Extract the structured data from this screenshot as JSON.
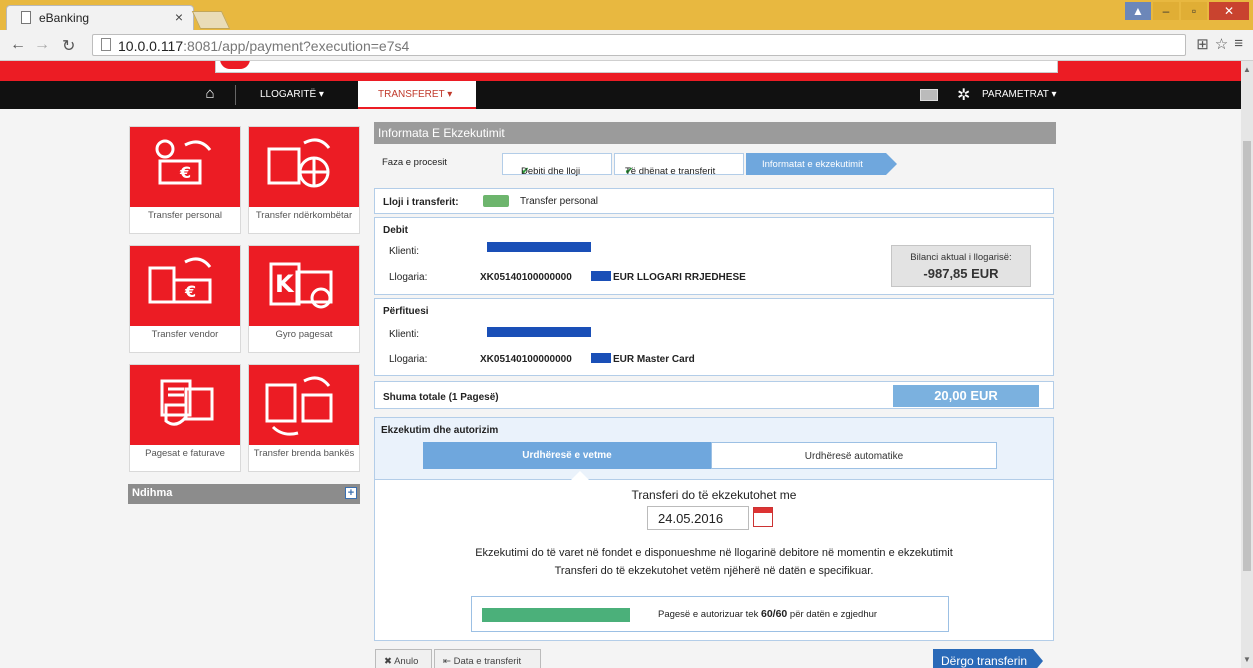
{
  "browser": {
    "tab_title": "eBanking",
    "tab_close": "×",
    "url_host": "10.0.0.117",
    "url_rest": ":8081/app/payment?execution=e7s4"
  },
  "nav": {
    "accounts": "LLOGARITË ▾",
    "transfers": "TRANSFERET ▾",
    "settings": "PARAMETRAT ▾"
  },
  "tiles": [
    {
      "label": "Transfer personal",
      "icon": "person-money-icon"
    },
    {
      "label": "Transfer ndërkombëtar",
      "icon": "building-globe-icon"
    },
    {
      "label": "Transfer vendor",
      "icon": "building-money-icon"
    },
    {
      "label": "Gyro pagesat",
      "icon": "currency-document-icon"
    },
    {
      "label": "Pagesat e faturave",
      "icon": "shield-invoice-icon"
    },
    {
      "label": "Transfer brenda bankës",
      "icon": "building-transfer-icon"
    }
  ],
  "help": {
    "label": "Ndihma",
    "plus": "+"
  },
  "section": {
    "title": "Informata E Ekzekutimit"
  },
  "process": {
    "label": "Faza e procesit",
    "steps": [
      "Debiti dhe lloji",
      "Të dhënat e transferit",
      "Informatat e ekzekutimit"
    ]
  },
  "transfer_type": {
    "label": "Lloji i transferit:",
    "value": "Transfer personal"
  },
  "debit": {
    "title": "Debit",
    "client_label": "Klienti:",
    "account_label": "Llogaria:",
    "account_prefix": "XK05140100000000",
    "account_suffix": "EUR LLOGARI RRJEDHESE",
    "balance_label": "Bilanci aktual i llogarisë:",
    "balance_value": "-987,85 EUR"
  },
  "beneficiary": {
    "title": "Përfituesi",
    "client_label": "Klienti:",
    "account_label": "Llogaria:",
    "account_prefix": "XK05140100000000",
    "account_suffix": "EUR Master Card"
  },
  "total": {
    "label": "Shuma totale (1 Pagesë)",
    "value": "20,00 EUR"
  },
  "execution": {
    "title": "Ekzekutim dhe autorizim",
    "tab_single": "Urdhëresë e vetme",
    "tab_auto": "Urdhëresë automatike",
    "heading": "Transferi do të ekzekutohet me",
    "date": "24.05.2016",
    "note1": "Ekzekutimi do të varet në fondet e disponueshme në llogarinë debitore në momentin e ekzekutimit",
    "note2": "Transferi do të ekzekutohet vetëm njëherë në datën e specifikuar.",
    "auth_pre": "Pagesë e autorizuar tek",
    "auth_count": "60/60",
    "auth_post": "për datën e zgjedhur",
    "auth_fraction": 1.0
  },
  "buttons": {
    "cancel": "✖ Anulo",
    "date_back": "⇤ Data e transferit",
    "send": "Dërgo transferin"
  },
  "colors": {
    "brand_red": "#ec1c24",
    "accent_blue": "#6fa7dd",
    "send_blue": "#2a6ab8"
  }
}
